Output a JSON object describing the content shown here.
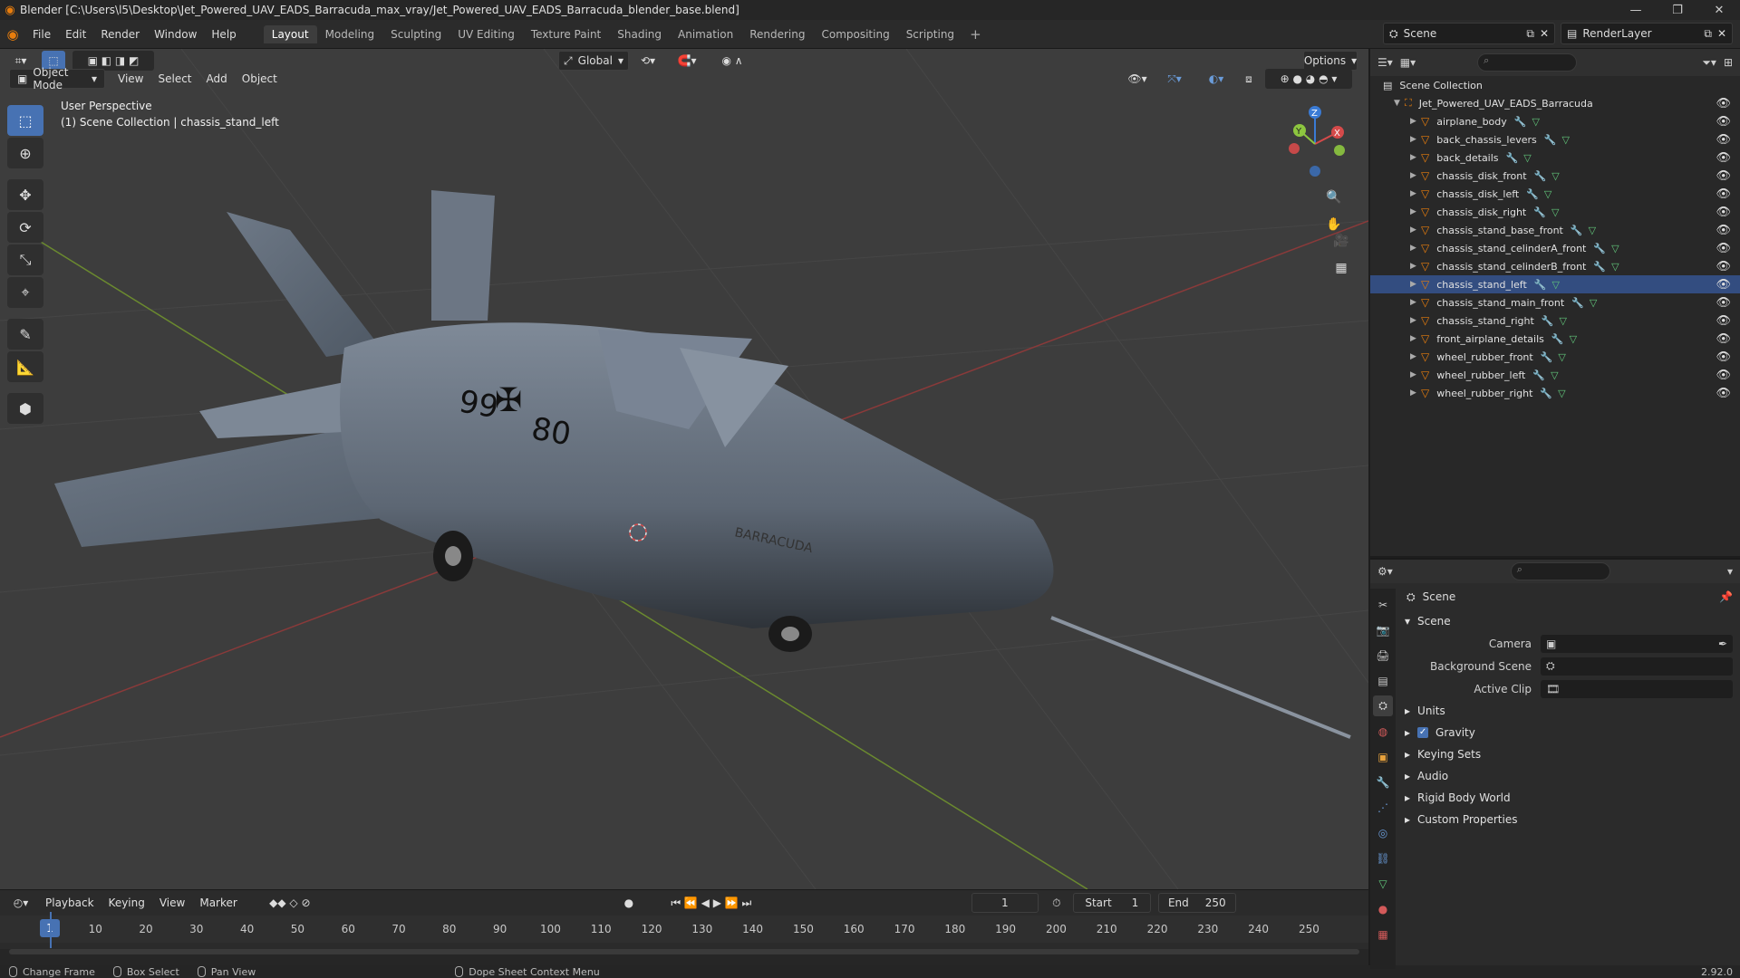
{
  "window": {
    "title": "Blender [C:\\Users\\l5\\Desktop\\Jet_Powered_UAV_EADS_Barracuda_max_vray/Jet_Powered_UAV_EADS_Barracuda_blender_base.blend]"
  },
  "menu": [
    "File",
    "Edit",
    "Render",
    "Window",
    "Help"
  ],
  "workspaces": [
    "Layout",
    "Modeling",
    "Sculpting",
    "UV Editing",
    "Texture Paint",
    "Shading",
    "Animation",
    "Rendering",
    "Compositing",
    "Scripting"
  ],
  "active_workspace": "Layout",
  "scene": {
    "name": "Scene",
    "render_layer": "RenderLayer"
  },
  "viewport": {
    "transform_orientation": "Global",
    "options_label": "Options",
    "mode": "Object Mode",
    "header_menus": [
      "View",
      "Select",
      "Add",
      "Object"
    ],
    "perspective": "User Perspective",
    "collection_info": "(1) Scene Collection | chassis_stand_left",
    "fuselage_text": "99",
    "fuselage_text2": "80",
    "brand_text": "BARRACUDA",
    "axis_x": "X",
    "axis_y": "Y",
    "axis_z": "Z"
  },
  "timeline": {
    "menus": [
      "Playback",
      "Keying",
      "View",
      "Marker"
    ],
    "current_frame": "1",
    "start_label": "Start",
    "start": "1",
    "end_label": "End",
    "end": "250",
    "ticks": [
      "10",
      "20",
      "30",
      "40",
      "50",
      "60",
      "70",
      "80",
      "90",
      "100",
      "110",
      "120",
      "130",
      "140",
      "150",
      "160",
      "170",
      "180",
      "190",
      "200",
      "210",
      "220",
      "230",
      "240",
      "250"
    ]
  },
  "outliner": {
    "root": "Scene Collection",
    "collection": "Jet_Powered_UAV_EADS_Barracuda",
    "items": [
      "airplane_body",
      "back_chassis_levers",
      "back_details",
      "chassis_disk_front",
      "chassis_disk_left",
      "chassis_disk_right",
      "chassis_stand_base_front",
      "chassis_stand_celinderA_front",
      "chassis_stand_celinderB_front",
      "chassis_stand_left",
      "chassis_stand_main_front",
      "chassis_stand_right",
      "front_airplane_details",
      "wheel_rubber_front",
      "wheel_rubber_left",
      "wheel_rubber_right"
    ],
    "selected": "chassis_stand_left"
  },
  "properties": {
    "context": "Scene",
    "panel": "Scene",
    "fields": [
      {
        "label": "Camera"
      },
      {
        "label": "Background Scene"
      },
      {
        "label": "Active Clip"
      }
    ],
    "sections": [
      "Units",
      "Gravity",
      "Keying Sets",
      "Audio",
      "Rigid Body World",
      "Custom Properties"
    ]
  },
  "statusbar": {
    "items": [
      "Change Frame",
      "Box Select",
      "Pan View",
      "Dope Sheet Context Menu"
    ],
    "version": "2.92.0"
  },
  "colors": {
    "accent": "#4772b3",
    "blender_orange": "#e87d0d",
    "x_axis": "#d54a4a",
    "y_axis": "#8dc63f",
    "z_axis": "#3a7bd5"
  }
}
